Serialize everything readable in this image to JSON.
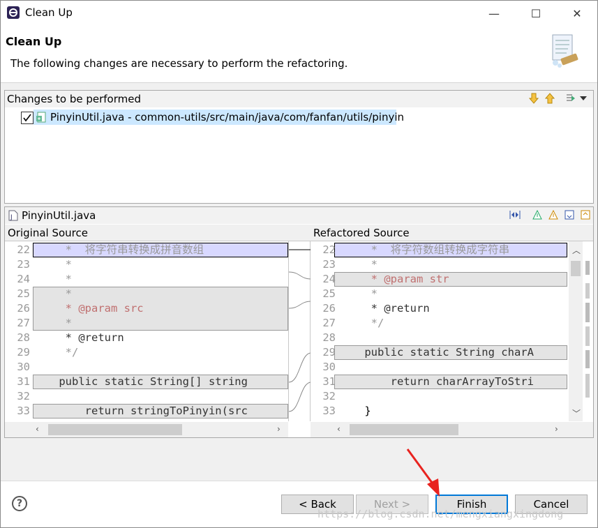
{
  "window": {
    "title": "Clean Up",
    "minimize_glyph": "—",
    "maximize_glyph": "☐",
    "close_glyph": "✕"
  },
  "header": {
    "title": "Clean Up",
    "description": "The following changes are necessary to perform the refactoring."
  },
  "changes": {
    "label": "Changes to be performed",
    "items": [
      {
        "label": "PinyinUtil.java - common-utils/src/main/java/com/fanfan/utils/pinyin",
        "checked": true
      }
    ]
  },
  "compare": {
    "file_label": "PinyinUtil.java",
    "original_header": "Original Source",
    "refactored_header": "Refactored Source",
    "original_lines": [
      {
        "n": "22",
        "text": "     *  将字符串转换成拼音数组"
      },
      {
        "n": "23",
        "text": "     *"
      },
      {
        "n": "24",
        "text": "     *"
      },
      {
        "n": "25",
        "text": "     *"
      },
      {
        "n": "26",
        "text": "     * @param src"
      },
      {
        "n": "27",
        "text": "     *"
      },
      {
        "n": "28",
        "text": "     * @return"
      },
      {
        "n": "29",
        "text": "     */"
      },
      {
        "n": "30",
        "text": ""
      },
      {
        "n": "31",
        "text": "    public static String[] string"
      },
      {
        "n": "32",
        "text": ""
      },
      {
        "n": "33",
        "text": "        return stringToPinyin(src"
      }
    ],
    "refactored_lines": [
      {
        "n": "22",
        "text": "     *  将字符数组转换成字符串"
      },
      {
        "n": "23",
        "text": "     *"
      },
      {
        "n": "24",
        "text": "     * @param str"
      },
      {
        "n": "25",
        "text": "     *"
      },
      {
        "n": "26",
        "text": "     * @return"
      },
      {
        "n": "27",
        "text": "     */"
      },
      {
        "n": "28",
        "text": ""
      },
      {
        "n": "29",
        "text": "    public static String charA"
      },
      {
        "n": "30",
        "text": ""
      },
      {
        "n": "31",
        "text": "        return charArrayToStri"
      },
      {
        "n": "32",
        "text": ""
      },
      {
        "n": "33",
        "text": "    }"
      }
    ]
  },
  "buttons": {
    "help": "?",
    "back": "< Back",
    "next": "Next >",
    "finish": "Finish",
    "cancel": "Cancel"
  },
  "watermark": "https://blog.csdn.net/mengxiangxingdong",
  "colors": {
    "accent": "#0078d7",
    "selection": "#cce8ff",
    "arrow": "#e8231f"
  }
}
